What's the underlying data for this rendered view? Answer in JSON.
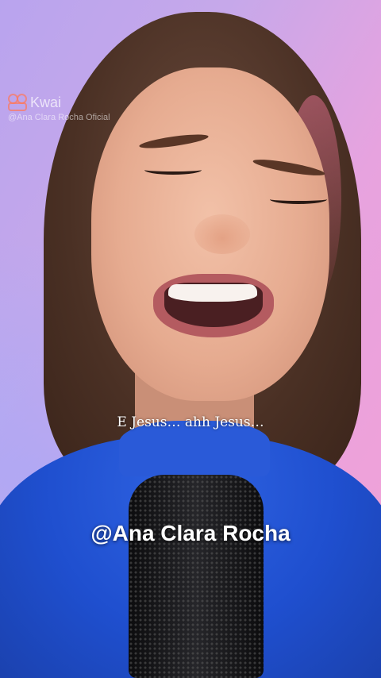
{
  "watermark": {
    "brand": "Kwai",
    "user": "@Ana Clara Rocha Oficial",
    "icon": "kwai-logo-icon"
  },
  "subtitle": "E Jesus… ahh Jesus…",
  "overlay_handle": "@Ana Clara Rocha",
  "colors": {
    "background_left": "#b9a4ee",
    "background_right": "#f3a1d6",
    "sweater": "#1f4fcf",
    "text": "#ffffff"
  }
}
